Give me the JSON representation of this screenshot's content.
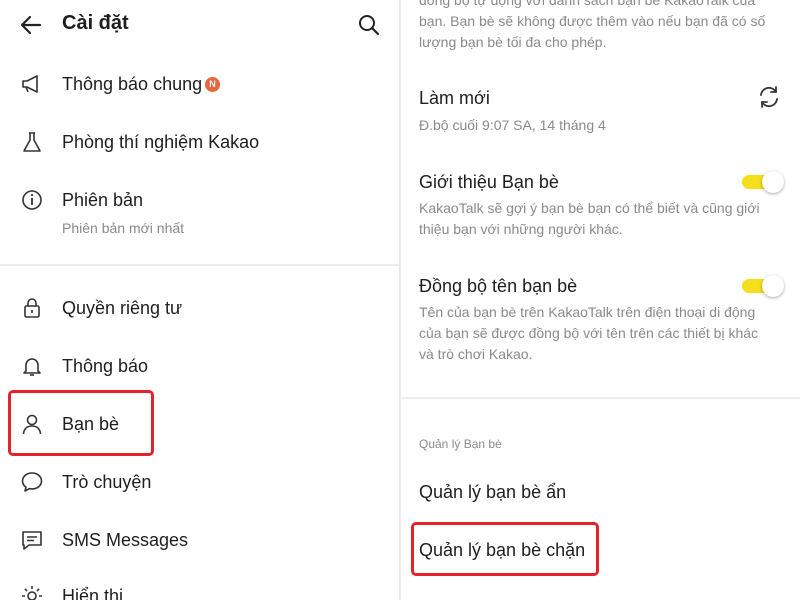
{
  "left": {
    "header": {
      "title": "Cài đặt"
    },
    "items": [
      {
        "label": "Thông báo chung",
        "badge": "N",
        "icon": "megaphone-icon"
      },
      {
        "label": "Phòng thí nghiệm Kakao",
        "icon": "flask-icon"
      },
      {
        "label": "Phiên bản",
        "sub": "Phiên bản mới nhất",
        "icon": "info-icon"
      },
      {
        "label": "Quyền riêng tư",
        "icon": "lock-icon"
      },
      {
        "label": "Thông báo",
        "icon": "bell-icon"
      },
      {
        "label": "Bạn bè",
        "icon": "person-icon"
      },
      {
        "label": "Trò chuyện",
        "icon": "chat-bubble-icon"
      },
      {
        "label": "SMS Messages",
        "icon": "sms-icon"
      },
      {
        "label": "Hiển thị",
        "icon": "brightness-icon"
      }
    ]
  },
  "right": {
    "top_text_lines": [
      "đồng bộ tự động với danh sách bạn bè KakaoTalk của",
      "bạn. Bạn bè sẽ không được thêm vào nếu bạn đã có số",
      "lượng bạn bè tối đa cho phép."
    ],
    "refresh": {
      "title": "Làm mới",
      "sub": "Đ.bộ cuối 9:07 SA, 14 tháng 4"
    },
    "friend_recommend": {
      "title": "Giới thiệu Bạn bè",
      "desc_lines": [
        "KakaoTalk sẽ gợi ý bạn bè bạn có thể biết và cũng giới",
        "thiệu bạn với những người khác."
      ],
      "enabled": true
    },
    "sync_names": {
      "title": "Đồng bộ tên bạn bè",
      "desc_lines": [
        "Tên của bạn bè trên KakaoTalk trên điện thoại di động",
        "của bạn sẽ được đồng bộ với tên trên các thiết bị khác",
        "và trò chơi Kakao."
      ],
      "enabled": true
    },
    "manage_section": {
      "label": "Quản lý Bạn bè",
      "hidden": "Quản lý bạn bè ẩn",
      "blocked": "Quản lý bạn bè chặn"
    }
  },
  "colors": {
    "toggle_on": "#f5de1b",
    "highlight": "#e3252b",
    "badge": "#e8663d"
  }
}
